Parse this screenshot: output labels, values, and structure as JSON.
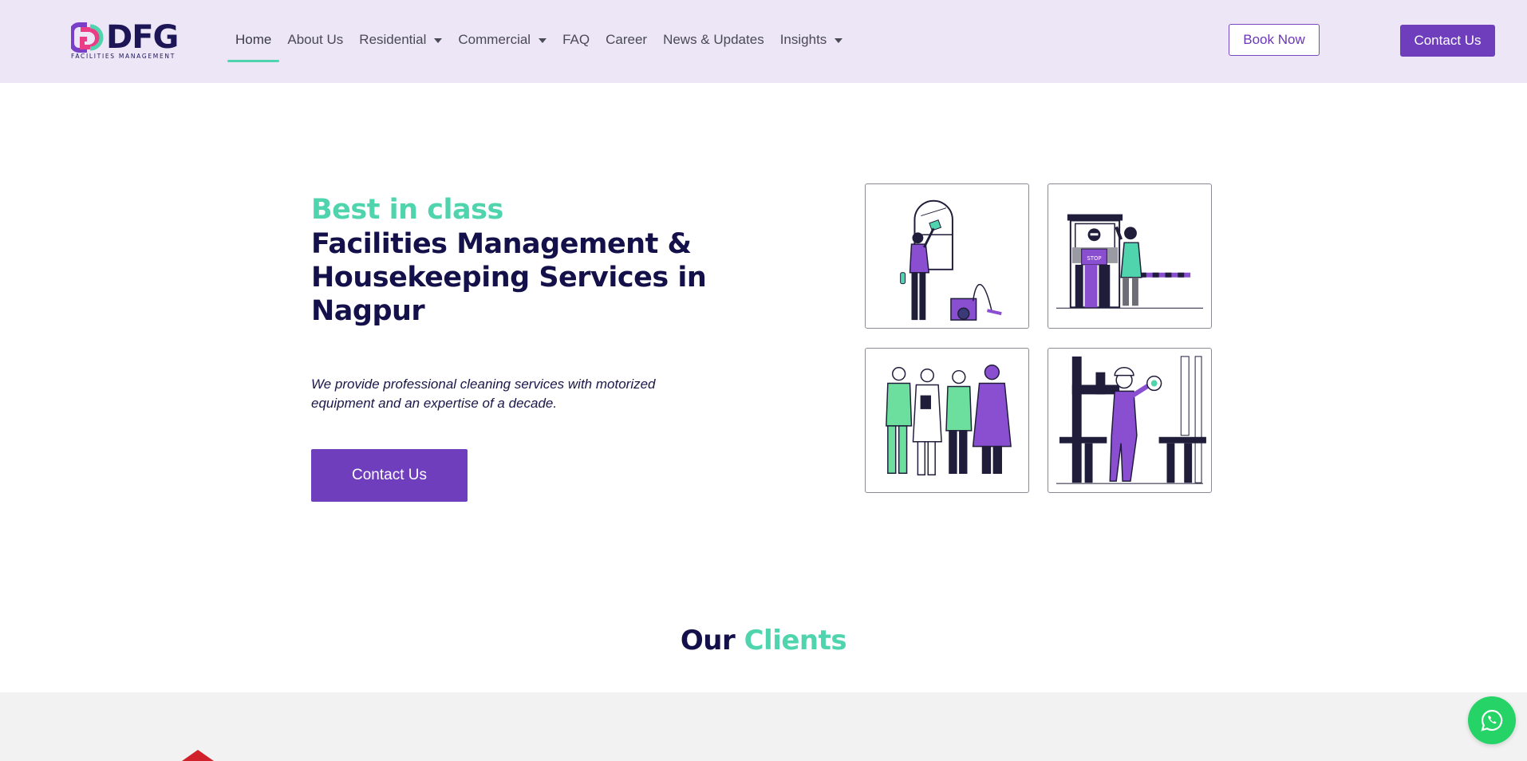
{
  "brand": {
    "name": "DFG",
    "tagline": "FACILITIES MANAGEMENT",
    "colors": {
      "primary": "#6e3ebd",
      "accent": "#4fd4ad",
      "dark": "#14104a",
      "header_bg": "#ece6f6"
    }
  },
  "nav": {
    "items": [
      {
        "label": "Home",
        "active": true,
        "dropdown": false
      },
      {
        "label": "About Us",
        "active": false,
        "dropdown": false
      },
      {
        "label": "Residential",
        "active": false,
        "dropdown": true
      },
      {
        "label": "Commercial",
        "active": false,
        "dropdown": true
      },
      {
        "label": "FAQ",
        "active": false,
        "dropdown": false
      },
      {
        "label": "Career",
        "active": false,
        "dropdown": false
      },
      {
        "label": "News & Updates",
        "active": false,
        "dropdown": false
      },
      {
        "label": "Insights",
        "active": false,
        "dropdown": true
      }
    ],
    "book_label": "Book Now",
    "contact_label": "Contact Us"
  },
  "hero": {
    "tag": "Best in class",
    "title": "Facilities Management & Housekeeping Services in Nagpur",
    "description": "We provide professional cleaning services with motorized equipment and an expertise of a decade.",
    "cta_label": "Contact Us",
    "illustrations": [
      {
        "icon": "window-cleaning-illustration"
      },
      {
        "icon": "security-guard-illustration",
        "sign_text": "STOP"
      },
      {
        "icon": "medical-staff-illustration"
      },
      {
        "icon": "plumbing-technician-illustration"
      }
    ]
  },
  "clients": {
    "title_main": "Our",
    "title_accent": "Clients"
  },
  "floating": {
    "icon": "whatsapp-icon"
  }
}
